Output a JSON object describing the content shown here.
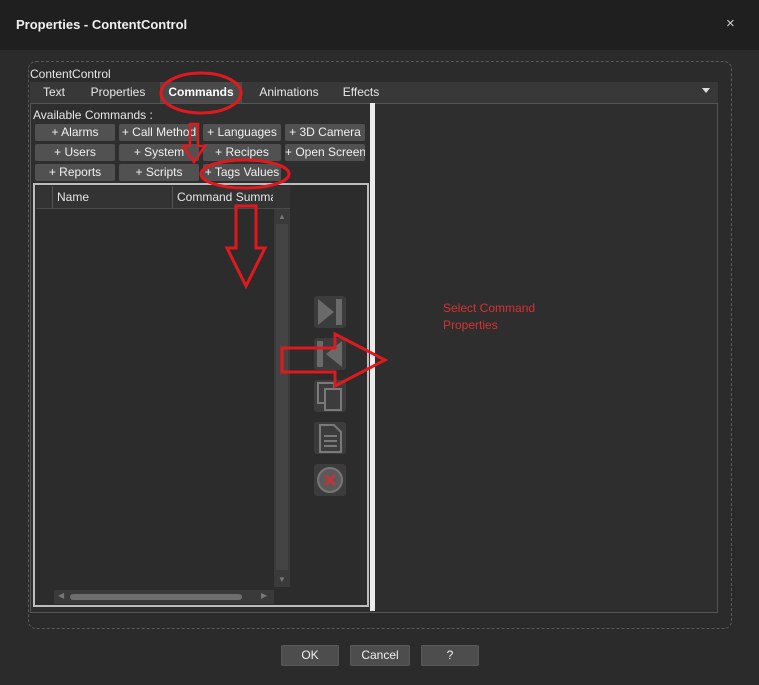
{
  "window": {
    "title": "Properties - ContentControl",
    "close_glyph": "×"
  },
  "group": {
    "label": "ContentControl"
  },
  "tabs": [
    {
      "label": "Text"
    },
    {
      "label": "Properties"
    },
    {
      "label": "Commands",
      "active": true
    },
    {
      "label": "Animations"
    },
    {
      "label": "Effects"
    }
  ],
  "commands": {
    "heading": "Available Commands :",
    "buttons": [
      "+ Alarms",
      "+ Call Method",
      "+ Languages",
      "+ 3D Camera",
      "+ Users",
      "+ System",
      "+ Recipes",
      "+ Open Screen",
      "+ Reports",
      "+ Scripts",
      "+ Tags Values"
    ]
  },
  "grid": {
    "columns": [
      "Name",
      "Command Summary"
    ]
  },
  "side_icons": [
    "move-last-icon",
    "move-first-icon",
    "copy-icon",
    "paste-icon",
    "delete-icon"
  ],
  "placeholder": {
    "line1": "Select Command",
    "line2": "Properties"
  },
  "footer": {
    "ok": "OK",
    "cancel": "Cancel",
    "help": "?"
  },
  "colors": {
    "annotation": "#e0191f",
    "placeholder_text": "#d63232",
    "background": "#2b2b2b"
  }
}
